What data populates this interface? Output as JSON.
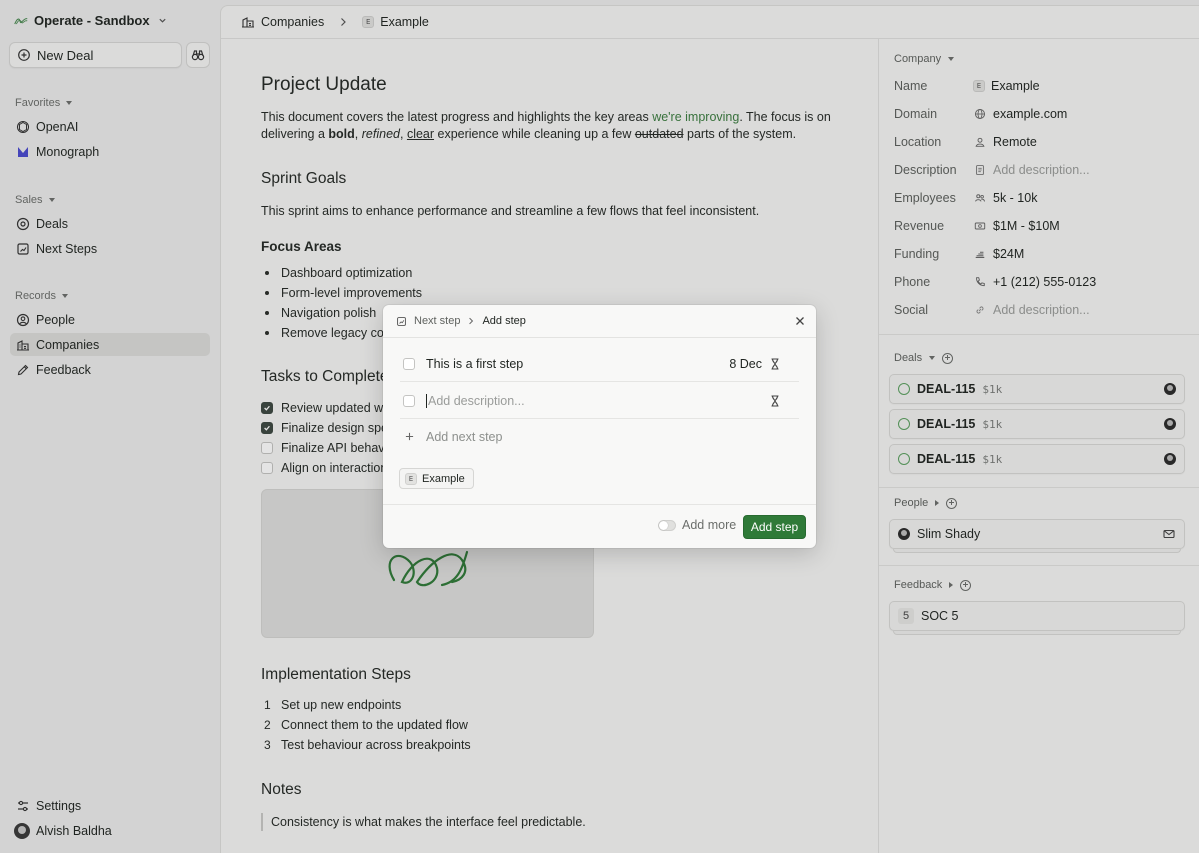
{
  "sidebar": {
    "workspace": "Operate - Sandbox",
    "new_deal": "New Deal",
    "favorites_label": "Favorites",
    "favorites": [
      "OpenAI",
      "Monograph"
    ],
    "sales_label": "Sales",
    "sales": [
      "Deals",
      "Next Steps"
    ],
    "records_label": "Records",
    "records": [
      "People",
      "Companies",
      "Feedback"
    ],
    "settings": "Settings",
    "user": "Alvish Baldha"
  },
  "breadcrumb": {
    "root": "Companies",
    "badge": "E",
    "current": "Example"
  },
  "doc": {
    "title": "Project Update",
    "intro": {
      "a": "This document covers the latest progress and highlights the key areas ",
      "link": "we're improving",
      "b": ". The focus is on delivering a ",
      "bold": "bold",
      "c": ", ",
      "italic": "refined",
      "d": ", ",
      "underline": "clear",
      "e": " experience while cleaning up a few ",
      "strike": "outdated",
      "f": " parts of the system."
    },
    "sprint_title": "Sprint Goals",
    "sprint_text": "This sprint aims to enhance performance and streamline a few flows that feel inconsistent.",
    "focus_title": "Focus Areas",
    "focus_items": [
      "Dashboard optimization",
      "Form-level improvements",
      "Navigation polish",
      "Remove legacy comp"
    ],
    "tasks_title": "Tasks to Complete",
    "tasks": [
      {
        "label": "Review updated wire",
        "done": true
      },
      {
        "label": "Finalize design specs",
        "done": true
      },
      {
        "label": "Finalize API behaviour",
        "done": false
      },
      {
        "label": "Align on interaction d",
        "done": false
      }
    ],
    "impl_title": "Implementation Steps",
    "impl_items": [
      "Set up new endpoints",
      "Connect them to the updated flow",
      "Test behaviour across breakpoints"
    ],
    "notes_title": "Notes",
    "quote": "Consistency is what makes the interface feel predictable."
  },
  "company": {
    "header": "Company",
    "props": [
      {
        "key": "Name",
        "value": "Example",
        "icon": "e-badge",
        "placeholder": false
      },
      {
        "key": "Domain",
        "value": "example.com",
        "icon": "globe-icon",
        "placeholder": false
      },
      {
        "key": "Location",
        "value": "Remote",
        "icon": "location-icon",
        "placeholder": false
      },
      {
        "key": "Description",
        "value": "Add description...",
        "icon": "doc-icon",
        "placeholder": true
      },
      {
        "key": "Employees",
        "value": "5k - 10k",
        "icon": "people-icon",
        "placeholder": false
      },
      {
        "key": "Revenue",
        "value": "$1M - $10M",
        "icon": "money-icon",
        "placeholder": false
      },
      {
        "key": "Funding",
        "value": "$24M",
        "icon": "funding-icon",
        "placeholder": false
      },
      {
        "key": "Phone",
        "value": "+1 (212) 555-0123",
        "icon": "phone-icon",
        "placeholder": false
      },
      {
        "key": "Social",
        "value": "Add description...",
        "icon": "link-icon",
        "placeholder": true
      }
    ]
  },
  "deals": {
    "header": "Deals",
    "items": [
      {
        "id": "DEAL-115",
        "amount": "$1k"
      },
      {
        "id": "DEAL-115",
        "amount": "$1k"
      },
      {
        "id": "DEAL-115",
        "amount": "$1k"
      }
    ]
  },
  "people": {
    "header": "People",
    "name": "Slim Shady"
  },
  "feedback": {
    "header": "Feedback",
    "count": "5",
    "title": "SOC 5"
  },
  "modal": {
    "crumb_parent": "Next step",
    "crumb_current": "Add step",
    "step_text": "This is a first step",
    "step_date": "8 Dec",
    "desc_placeholder": "Add description...",
    "add_next": "Add next step",
    "chip_badge": "E",
    "chip_label": "Example",
    "add_more": "Add more",
    "submit": "Add step"
  },
  "colors": {
    "accent": "#2f7a38",
    "link": "#3c7d40",
    "ring": "#5aa05f"
  }
}
